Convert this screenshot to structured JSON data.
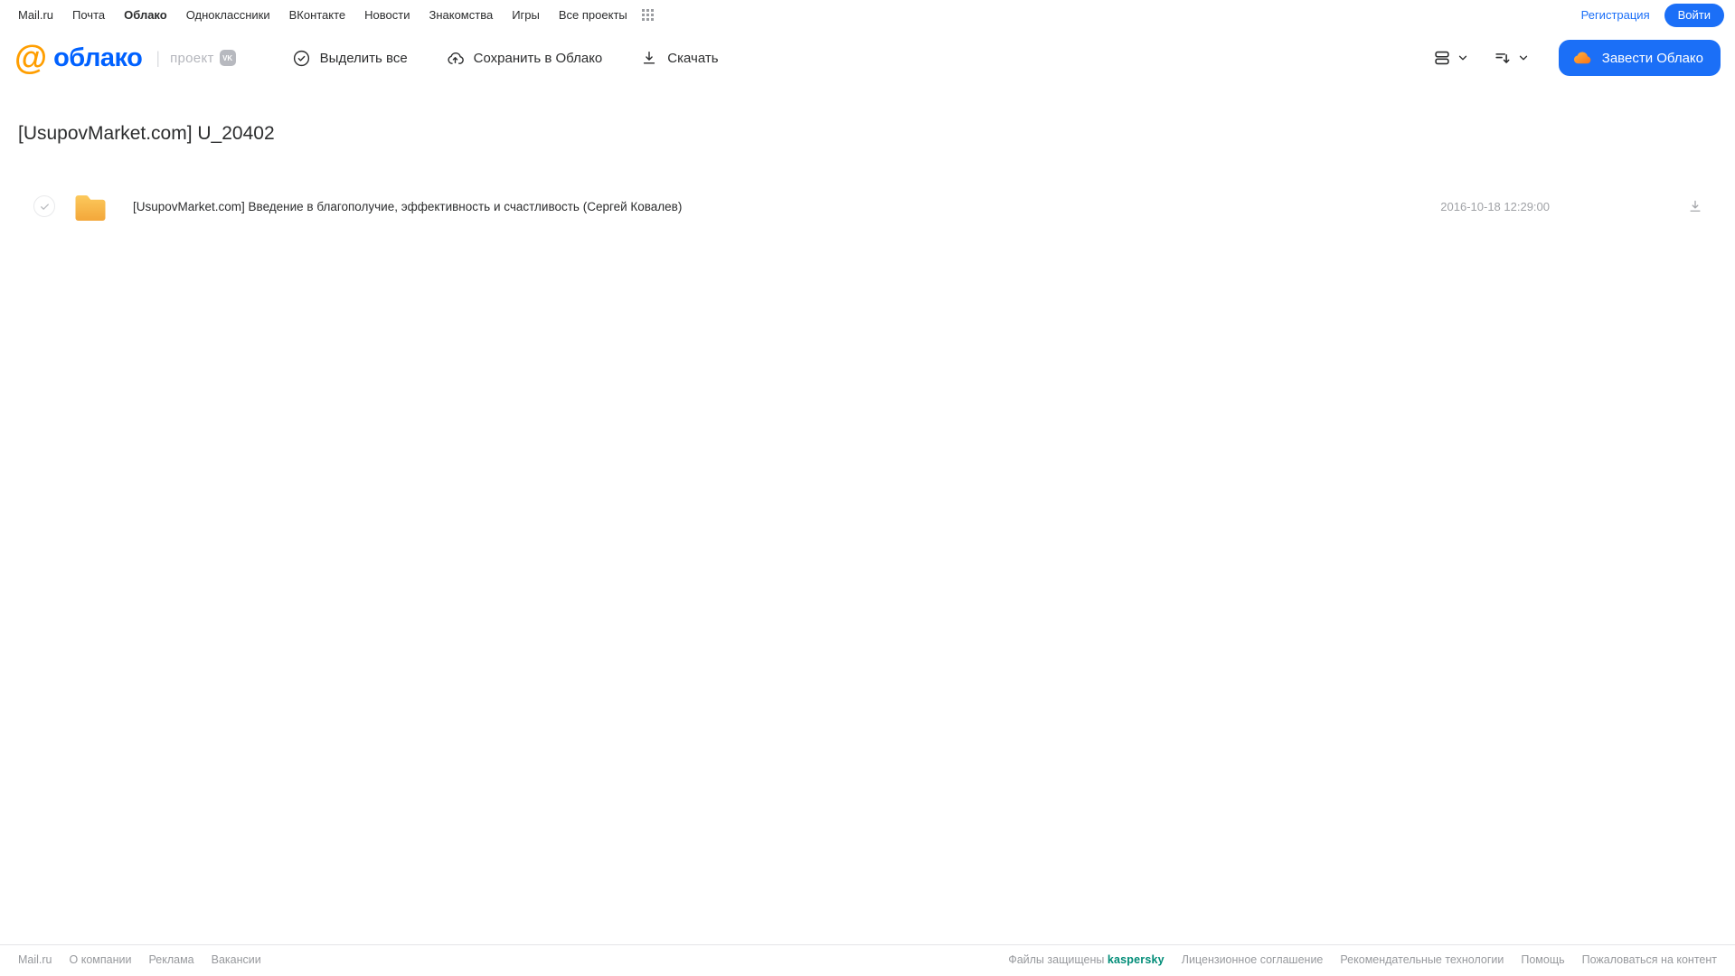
{
  "topnav": {
    "items": [
      "Mail.ru",
      "Почта",
      "Облако",
      "Одноклассники",
      "ВКонтакте",
      "Новости",
      "Знакомства",
      "Игры",
      "Все проекты"
    ],
    "active_item": "Облако",
    "registration_link": "Регистрация",
    "login_button": "Войти"
  },
  "toolbar": {
    "logo_at": "@",
    "logo_text": "облако",
    "project_label": "проект",
    "vk_badge": "VK",
    "select_all_label": "Выделить все",
    "save_to_cloud_label": "Сохранить в Облако",
    "download_label": "Скачать",
    "get_cloud_button": "Завести Облако"
  },
  "page": {
    "title": "[UsupovMarket.com] U_20402"
  },
  "file_list": [
    {
      "type": "folder",
      "name": "[UsupovMarket.com] Введение в благополучие, эффективность и счастливость (Сергей Ковалев)",
      "modified": "2016-10-18 12:29:00"
    }
  ],
  "footer": {
    "left_links": [
      "Mail.ru",
      "О компании",
      "Реклама",
      "Вакансии"
    ],
    "protected_text": "Файлы защищены",
    "kaspersky_label": "kaspersky",
    "right_links": [
      "Лицензионное соглашение",
      "Рекомендательные технологии",
      "Помощь",
      "Пожаловаться на контент"
    ]
  },
  "colors": {
    "accent_blue": "#1b6ff7",
    "logo_blue": "#0061ff",
    "logo_orange": "#ff9e00",
    "folder_amber_top": "#fcc95c",
    "folder_amber_bottom": "#f3a73a",
    "kaspersky_teal": "#008c77",
    "muted_gray": "#a0a2a6"
  }
}
